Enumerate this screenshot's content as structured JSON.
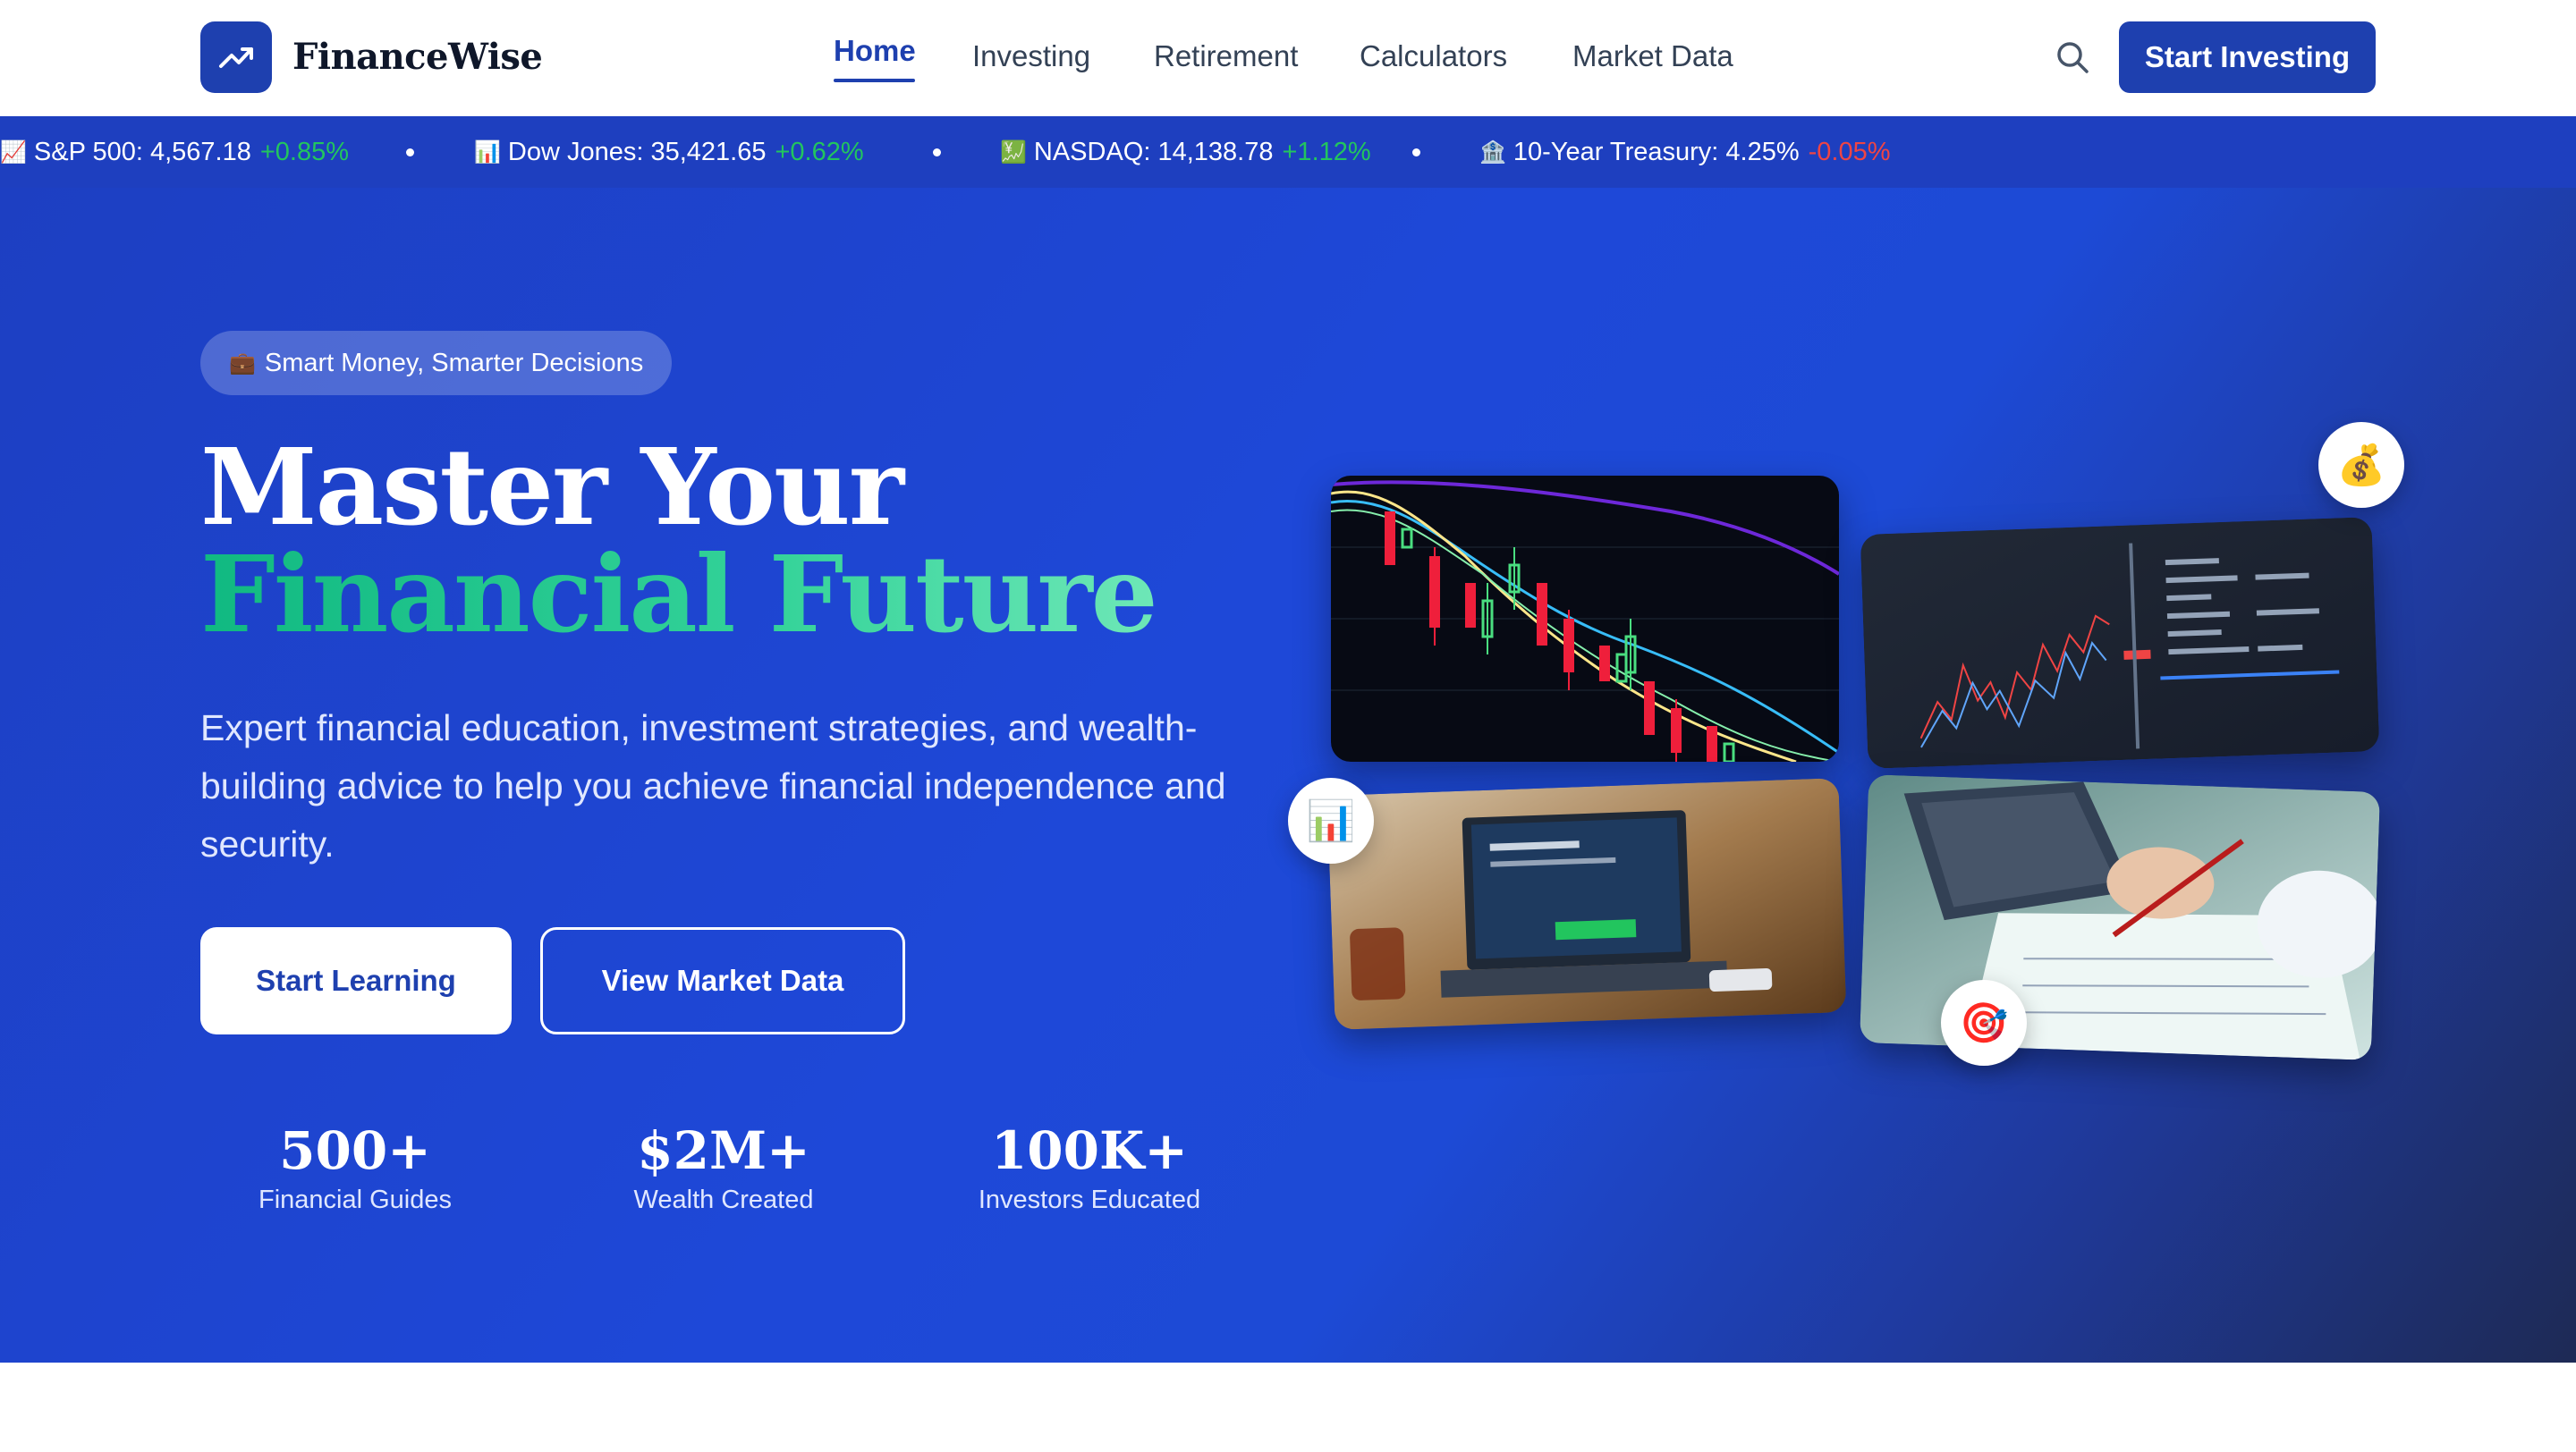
{
  "header": {
    "brand": "FinanceWise",
    "nav": [
      {
        "label": "Home",
        "active": true
      },
      {
        "label": "Investing"
      },
      {
        "label": "Retirement"
      },
      {
        "label": "Calculators"
      },
      {
        "label": "Market Data"
      }
    ],
    "cta_label": "Start Investing",
    "icons": {
      "logo": "trending-up-icon",
      "search": "search-icon"
    }
  },
  "ticker": {
    "items": [
      {
        "emoji": "📈",
        "label": "S&P 500: 4,567.18",
        "change": "+0.85%",
        "direction": "up"
      },
      {
        "emoji": "📊",
        "label": "Dow Jones: 35,421.65",
        "change": "+0.62%",
        "direction": "up"
      },
      {
        "emoji": "💹",
        "label": "NASDAQ: 14,138.78",
        "change": "+1.12%",
        "direction": "up"
      },
      {
        "emoji": "🏦",
        "label": "10-Year Treasury: 4.25%",
        "change": "-0.05%",
        "direction": "down"
      }
    ]
  },
  "hero": {
    "badge_emoji": "💼",
    "badge_text": "Smart Money, Smarter Decisions",
    "title_line1": "Master Your",
    "title_line2": "Financial Future",
    "subtitle": "Expert financial education, investment strategies, and wealth-building advice to help you achieve financial independence and security.",
    "primary_button": "Start Learning",
    "secondary_button": "View Market Data",
    "stats": [
      {
        "value": "500+",
        "label": "Financial Guides"
      },
      {
        "value": "$2M+",
        "label": "Wealth Created"
      },
      {
        "value": "100K+",
        "label": "Investors Educated"
      }
    ],
    "float_icons": {
      "money_bag": "💰",
      "chart": "📊",
      "target": "🎯"
    }
  },
  "colors": {
    "brand": "#1e40af",
    "hero_gradient_start": "#1d3fc2",
    "hero_gradient_end": "#1e2a55",
    "accent_green": "#22c55e",
    "negative_red": "#ef4444"
  }
}
